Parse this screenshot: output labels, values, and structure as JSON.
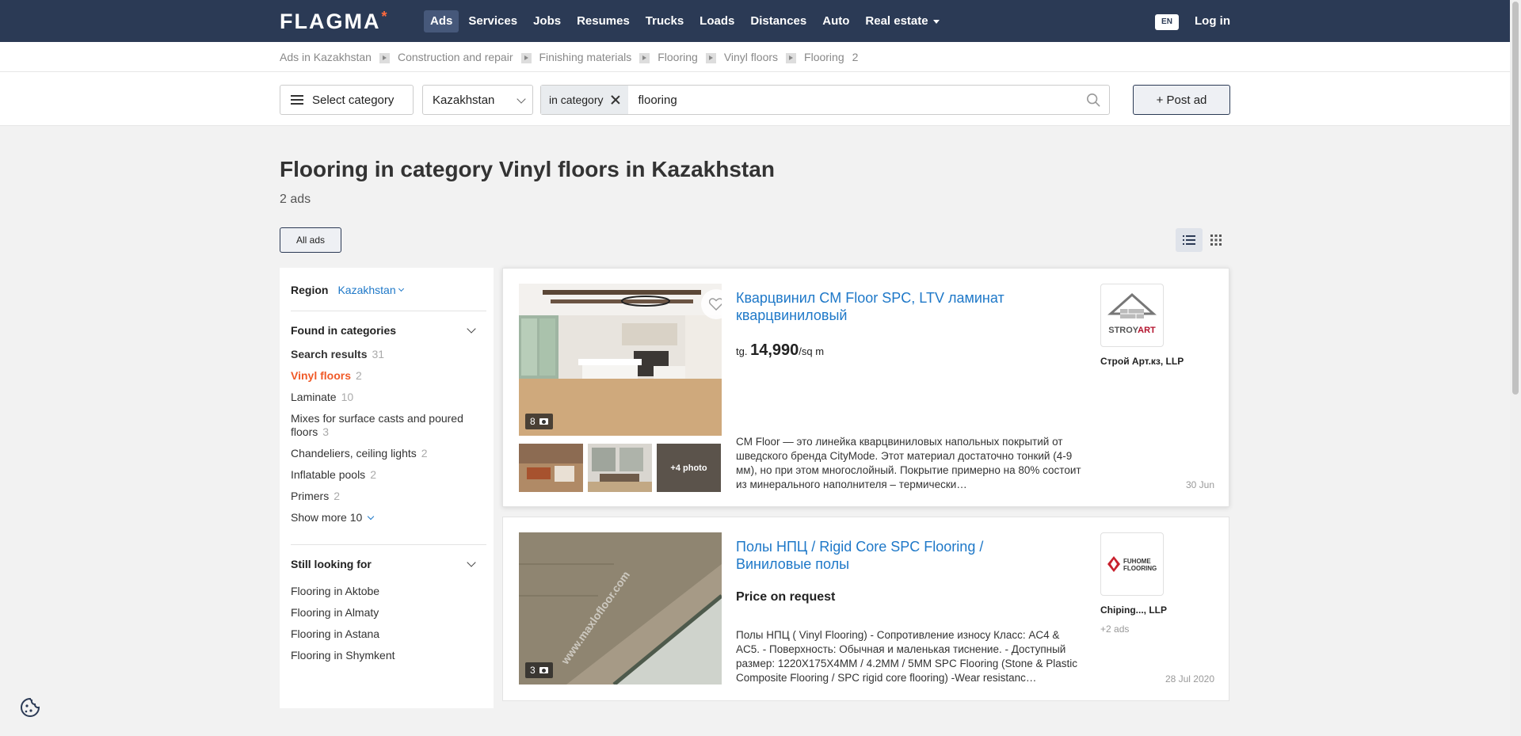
{
  "brand": {
    "logo": "FLAGMA"
  },
  "nav": {
    "items": [
      "Ads",
      "Services",
      "Jobs",
      "Resumes",
      "Trucks",
      "Loads",
      "Distances",
      "Auto",
      "Real estate"
    ],
    "lang": "EN",
    "login": "Log in"
  },
  "breadcrumb": {
    "items": [
      "Ads in Kazakhstan",
      "Construction and repair",
      "Finishing materials",
      "Flooring",
      "Vinyl floors",
      "Flooring"
    ],
    "count": "2"
  },
  "search": {
    "category_button": "Select category",
    "region": "Kazakhstan",
    "chip": "in category",
    "query": "flooring",
    "post_ad": "+ Post ad"
  },
  "heading": {
    "title": "Flooring in category Vinyl floors in Kazakhstan",
    "count": "2 ads",
    "all_ads": "All ads"
  },
  "sidebar": {
    "region_label": "Region",
    "region_value": "Kazakhstan",
    "found_title": "Found in categories",
    "categories": [
      {
        "label": "Search results",
        "count": "31"
      },
      {
        "label": "Vinyl floors",
        "count": "2"
      },
      {
        "label": "Laminate",
        "count": "10"
      },
      {
        "label": "Mixes for surface casts and poured floors",
        "count": "3"
      },
      {
        "label": "Chandeliers, ceiling lights",
        "count": "2"
      },
      {
        "label": "Inflatable pools",
        "count": "2"
      },
      {
        "label": "Primers",
        "count": "2"
      }
    ],
    "show_more": "Show more 10",
    "looking_title": "Still looking for",
    "looking": [
      "Flooring in Aktobe",
      "Flooring in Almaty",
      "Flooring in Astana",
      "Flooring in Shymkent"
    ]
  },
  "listings": [
    {
      "title": "Кварцвинил CM Floor SPC, LTV ламинат кварцвиниловый",
      "price_currency": "tg.",
      "price_value": "14,990",
      "price_unit": "/sq m",
      "photos": "8",
      "more_photos": "+4 photo",
      "description": "CM Floor — это линейка кварцвиниловых напольных покрытий от шведского бренда CityMode. Этот материал достаточно тонкий (4-9 мм), но при этом многослойный. Покрытие примерно на 80% состоит из минерального наполнителя – термически…",
      "seller_logo_text": "STROYART",
      "seller": "Строй Арт.кз, LLP",
      "date": "30 Jun"
    },
    {
      "title": "Полы НПЦ / Rigid Core SPC Flooring / Виниловые полы",
      "price": "Price on request",
      "photos": "3",
      "watermark": "www.maxlofloor.com",
      "description": "Полы НПЦ ( Vinyl Flooring) - Сопротивление износу Класс: AC4 & AC5. - Поверхность: Обычная и маленькая тиснение. - Доступный размер: 1220X175X4MM / 4.2MM / 5MM SPC Flooring (Stone & Plastic Composite Flooring / SPC rigid core flooring) -Wear resistanc…",
      "seller_logo_text": "FUHOME FLOORING",
      "seller": "Chiping..., LLP",
      "seller_extra": "+2 ads",
      "date": "28 Jul 2020"
    }
  ],
  "colors": {
    "header": "#2b3a55",
    "link": "#1e78c8",
    "accent": "#f05a28"
  }
}
